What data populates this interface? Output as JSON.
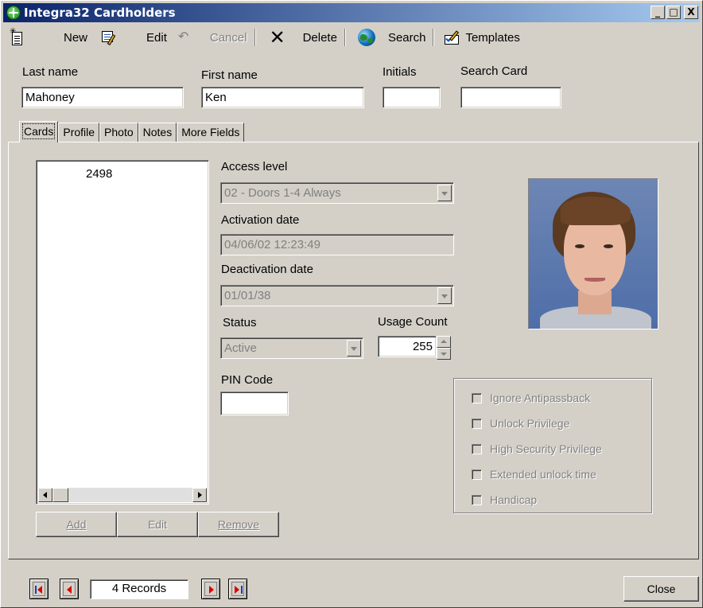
{
  "window": {
    "title": "Integra32 Cardholders",
    "buttons": {
      "minimize": "_",
      "maximize": "□",
      "close": "X"
    }
  },
  "toolbar": {
    "new_label": "New",
    "edit_label": "Edit",
    "cancel_label": "Cancel",
    "delete_label": "Delete",
    "search_label": "Search",
    "templates_label": "Templates"
  },
  "header": {
    "last_name_label": "Last name",
    "last_name_value": "Mahoney",
    "first_name_label": "First name",
    "first_name_value": "Ken",
    "initials_label": "Initials",
    "initials_value": "",
    "search_card_label": "Search Card",
    "search_card_value": ""
  },
  "tabs": [
    {
      "label": "Cards",
      "active": true
    },
    {
      "label": "Profile",
      "active": false
    },
    {
      "label": "Photo",
      "active": false
    },
    {
      "label": "Notes",
      "active": false
    },
    {
      "label": "More Fields",
      "active": false
    }
  ],
  "cards": {
    "list": [
      "2498"
    ],
    "add_label": "Add",
    "edit_label": "Edit",
    "remove_label": "Remove"
  },
  "card_details": {
    "access_level_label": "Access level",
    "access_level_value": "02 - Doors 1-4 Always",
    "activation_label": "Activation date",
    "activation_value": "04/06/02 12:23:49",
    "deactivation_label": "Deactivation date",
    "deactivation_value": "01/01/38",
    "status_label": "Status",
    "status_value": "Active",
    "usage_label": "Usage Count",
    "usage_value": "255",
    "pin_label": "PIN Code",
    "pin_value": ""
  },
  "privileges": [
    {
      "label": "Ignore Antipassback",
      "checked": false
    },
    {
      "label": "Unlock Privilege",
      "checked": false
    },
    {
      "label": "High Security Privilege",
      "checked": false
    },
    {
      "label": "Extended unlock time",
      "checked": false
    },
    {
      "label": "Handicap",
      "checked": false
    }
  ],
  "footer": {
    "records_text": "4 Records",
    "close_label": "Close"
  },
  "colors": {
    "face": "#d4d0c8",
    "title_start": "#0a246a",
    "title_end": "#a6caf0",
    "nav_arrow": "#e00000"
  }
}
